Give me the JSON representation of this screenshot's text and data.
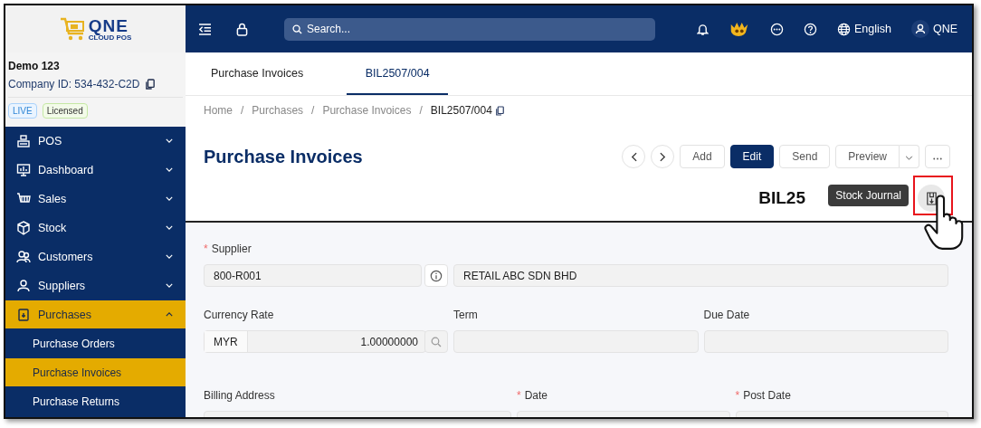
{
  "logo": {
    "title": "QNE",
    "subtitle": "CLOUD POS"
  },
  "company": {
    "name": "Demo 123",
    "id_label": "Company ID: 534-432-C2D",
    "badges": [
      {
        "label": "LIVE",
        "kind": "live"
      },
      {
        "label": "Licensed",
        "kind": "licensed"
      }
    ]
  },
  "sidebar": {
    "items": [
      {
        "label": "POS",
        "expanded": false,
        "selected": false
      },
      {
        "label": "Dashboard",
        "expanded": false,
        "selected": false
      },
      {
        "label": "Sales",
        "expanded": false,
        "selected": false
      },
      {
        "label": "Stock",
        "expanded": false,
        "selected": false
      },
      {
        "label": "Customers",
        "expanded": false,
        "selected": false
      },
      {
        "label": "Suppliers",
        "expanded": false,
        "selected": false
      },
      {
        "label": "Purchases",
        "expanded": true,
        "selected": true,
        "children": [
          {
            "label": "Purchase Orders",
            "selected": false
          },
          {
            "label": "Purchase Invoices",
            "selected": true
          },
          {
            "label": "Purchase Returns",
            "selected": false
          }
        ]
      }
    ]
  },
  "header": {
    "search": {
      "placeholder": "Search..."
    },
    "language": "English",
    "user": "QNE"
  },
  "tabs": [
    {
      "label": "Purchase Invoices",
      "selected": false
    },
    {
      "label": "BIL2507/004",
      "selected": true
    }
  ],
  "breadcrumb": [
    {
      "label": "Home",
      "kind": "link"
    },
    {
      "label": "/",
      "kind": "separator"
    },
    {
      "label": "Purchases",
      "kind": "link"
    },
    {
      "label": "/",
      "kind": "separator"
    },
    {
      "label": "Purchase Invoices",
      "kind": "link"
    },
    {
      "label": "/",
      "kind": "separator"
    },
    {
      "label": "BIL2507/004",
      "kind": "current"
    }
  ],
  "page_title": "Purchase Invoices",
  "toolbar": {
    "buttons": [
      {
        "label": "Add",
        "kind": "default"
      },
      {
        "label": "Edit",
        "kind": "primary"
      },
      {
        "label": "Send",
        "kind": "default"
      },
      {
        "label": "Preview",
        "kind": "split"
      }
    ]
  },
  "document": {
    "number": "BIL25",
    "tooltip": "Stock Journal"
  },
  "form": {
    "supplier": {
      "label": "Supplier",
      "required_mark": "*",
      "code": "800-R001",
      "name": "RETAIL ABC SDN BHD"
    },
    "currency_rate": {
      "label": "Currency Rate",
      "currency": "MYR",
      "value": "1.00000000"
    },
    "term": {
      "label": "Term"
    },
    "due_date": {
      "label": "Due Date"
    },
    "billing_address": {
      "label": "Billing Address"
    },
    "date": {
      "label": "Date",
      "required_mark": "*"
    },
    "post_date": {
      "label": "Post Date",
      "required_mark": "*"
    }
  }
}
